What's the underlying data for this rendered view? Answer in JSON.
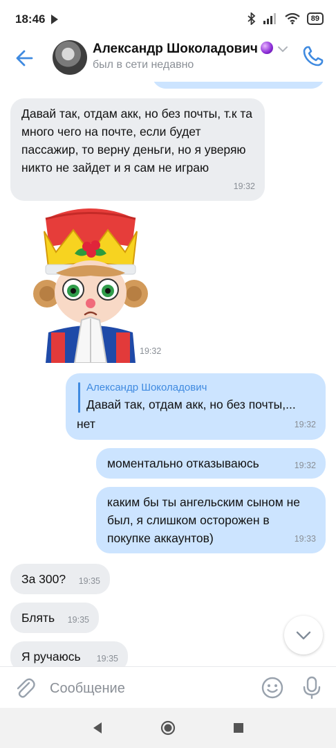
{
  "status_bar": {
    "time": "18:46",
    "battery": "89"
  },
  "header": {
    "name": "Александр Шоколадович",
    "presence": "был в сети недавно"
  },
  "messages": [
    {
      "text": "Давай так, отдам акк, но без почты, т.к та много чего на почте, если будет пассажир, то верну деньги, но я уверяю никто не зайдет и я сам не играю",
      "time": "19:32"
    },
    {
      "sticker": "nutcracker-praying-sticker",
      "time": "19:32"
    },
    {
      "reply_author": "Александр Шоколадович",
      "reply_text": "Давай так, отдам акк, но без почты,...",
      "text": "нет",
      "time": "19:32"
    },
    {
      "text": "моментально отказываюсь",
      "time": "19:32"
    },
    {
      "text": "каким бы ты ангельским сыном не был, я слишком осторожен в покупке аккаунтов)",
      "time": "19:33"
    },
    {
      "text": "За 300?",
      "time": "19:35"
    },
    {
      "text": "Блять",
      "time": "19:35"
    },
    {
      "text": "Я ручаюсь",
      "time": "19:35"
    }
  ],
  "composer": {
    "placeholder": "Сообщение"
  },
  "icons": {
    "back": "arrow-left-icon",
    "call": "phone-icon",
    "scroll_down": "chevron-down-icon",
    "attach": "paperclip-icon",
    "emoji": "smiley-icon",
    "mic": "microphone-icon",
    "nav_back": "triangle-back-icon",
    "nav_home": "circle-home-icon",
    "nav_recents": "square-recents-icon"
  },
  "colors": {
    "accent": "#3f8ae0",
    "incoming_bubble": "#ebedf0",
    "outgoing_bubble": "#cce4ff",
    "meta_text": "#8a8f96"
  }
}
